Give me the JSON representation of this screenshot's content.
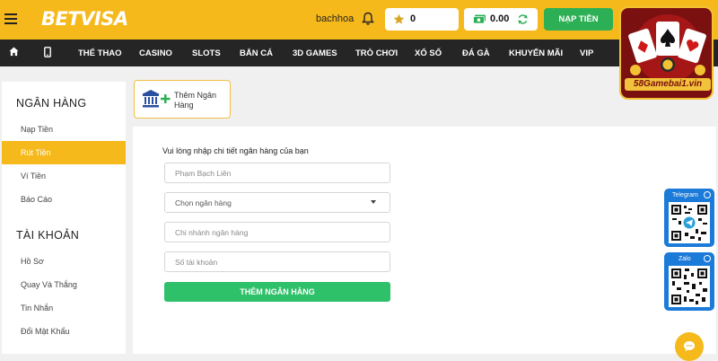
{
  "header": {
    "logo": "BETVISA",
    "username": "bachhoa",
    "points": "0",
    "balance": "0.00",
    "deposit_button": "NẠP TIỀN"
  },
  "nav": {
    "items": [
      "THỂ THAO",
      "CASINO",
      "SLOTS",
      "BẮN CÁ",
      "3D GAMES",
      "TRÒ CHƠI",
      "XỔ SỐ",
      "ĐÁ GÀ",
      "KHUYẾN MÃI",
      "VIP"
    ]
  },
  "sidebar": {
    "bank_heading": "NGÂN HÀNG",
    "bank_items": [
      "Nạp Tiền",
      "Rút Tiền",
      "Ví Tiền",
      "Báo Cáo"
    ],
    "account_heading": "TÀI KHOẢN",
    "account_items": [
      "Hồ Sơ",
      "Quay Và Thắng",
      "Tin Nhắn",
      "Đổi Mật Khẩu"
    ]
  },
  "add_bank_card": {
    "label": "Thêm Ngân Hàng"
  },
  "form": {
    "title": "Vui lòng nhập chi tiết ngân hàng của bạn",
    "name_placeholder": "Phạm Bạch Liên",
    "bank_select": "Chọn ngân hàng",
    "branch_placeholder": "Chi nhánh ngân hàng",
    "account_placeholder": "Số tài khoản",
    "submit": "THÊM NGÂN HÀNG"
  },
  "ad": {
    "label": "58Gamebai1.vin"
  },
  "telegram": {
    "label": "Telegram"
  },
  "zalo": {
    "label": "Zalo"
  }
}
